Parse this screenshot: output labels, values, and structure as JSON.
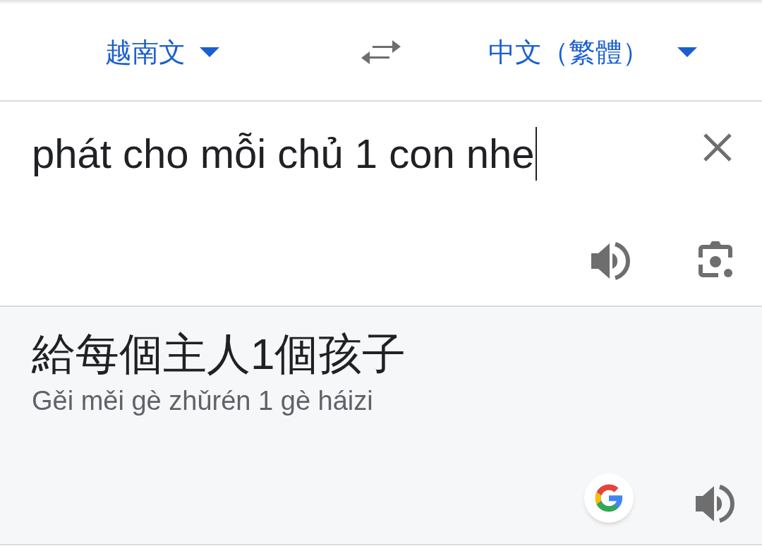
{
  "language_bar": {
    "source_language": "越南文",
    "target_language": "中文（繁體）"
  },
  "input": {
    "value": "phát cho mỗi chủ 1 con nhe"
  },
  "output": {
    "translation": "給每個主人1個孩子",
    "romanization": "Gěi měi gè zhǔrén 1 gè háizi"
  }
}
